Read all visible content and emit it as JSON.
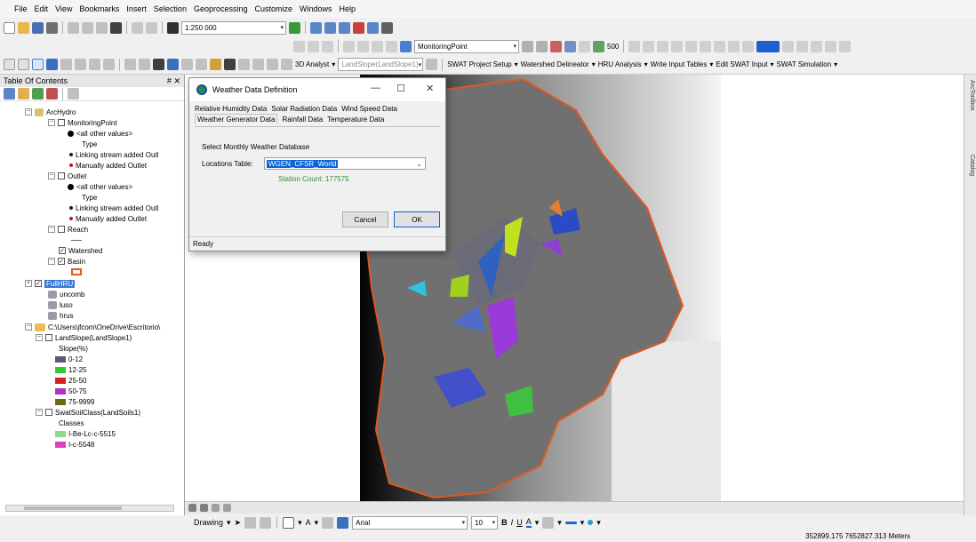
{
  "menu": [
    "File",
    "Edit",
    "View",
    "Bookmarks",
    "Insert",
    "Selection",
    "Geoprocessing",
    "Customize",
    "Windows",
    "Help"
  ],
  "toolbar": {
    "scale": "1:250 000",
    "layer_select": "MonitoringPoint",
    "tolerance": "500",
    "analyst_3d": "3D Analyst",
    "analyst_layer": "LandSlope(LandSlope1)",
    "swat_menus": [
      "SWAT Project Setup",
      "Watershed Delineator",
      "HRU Analysis",
      "Write Input Tables",
      "Edit SWAT Input",
      "SWAT Simulation"
    ]
  },
  "toc": {
    "title": "Table Of Contents",
    "close": "✕",
    "pin": "#",
    "groups": {
      "arc_hydro": "ArcHydro",
      "monitoring_point": "MonitoringPoint",
      "all_other_1": "<all other values>",
      "type_1": "Type",
      "linking_1": "Linking stream added Outl",
      "manual_1": "Manually added Outlet",
      "outlet": "Outlet",
      "all_other_2": "<all other values>",
      "type_2": "Type",
      "linking_2": "Linking stream added Outl",
      "manual_2": "Manually added Outlet",
      "reach": "Reach",
      "watershed": "Watershed",
      "basin": "Basin",
      "full_hru": "FullHRU",
      "uncomb": "uncomb",
      "luso": "luso",
      "hrus": "hrus",
      "folder": "C:\\Users\\jfcom\\OneDrive\\Escritorio\\",
      "landslope": "LandSlope(LandSlope1)",
      "slope_label": "Slope(%)",
      "slope_classes": [
        "0-12",
        "12-25",
        "25-50",
        "50-75",
        "75-9999"
      ],
      "soil": "SwatSoilClass(LandSoils1)",
      "classes_label": "Classes",
      "soil_classes": [
        "I-Be-Lc-c-5515",
        "I-c-5548"
      ]
    }
  },
  "colors": {
    "slope": [
      "#5b5b78",
      "#2ecc2e",
      "#d42020",
      "#b030c8",
      "#6b6b10"
    ],
    "soil": [
      "#8fd88f",
      "#e040c8"
    ],
    "point_linking": "#1a1a1a",
    "point_manual": "#c01818",
    "basin_outline": "#e05820"
  },
  "dialog": {
    "title": "Weather Data Definition",
    "tabs_row1": [
      "Relative Humidity Data",
      "Solar Radiation Data",
      "Wind Speed Data"
    ],
    "tabs_row2": [
      "Weather Generator Data",
      "Rainfall Data",
      "Temperature Data"
    ],
    "select_label": "Select Monthly Weather Database",
    "locations_label": "Locations Table:",
    "locations_value": "WGEN_CFSR_World",
    "station_count": "Station Count: 177575",
    "cancel": "Cancel",
    "ok": "OK",
    "status": "Ready"
  },
  "side_tabs": [
    "ArcToolbox",
    "Catalog"
  ],
  "drawing": {
    "label": "Drawing",
    "font": "Arial",
    "size": "10"
  },
  "status": {
    "coordinates": "352899.175  7652827.313 Meters"
  }
}
